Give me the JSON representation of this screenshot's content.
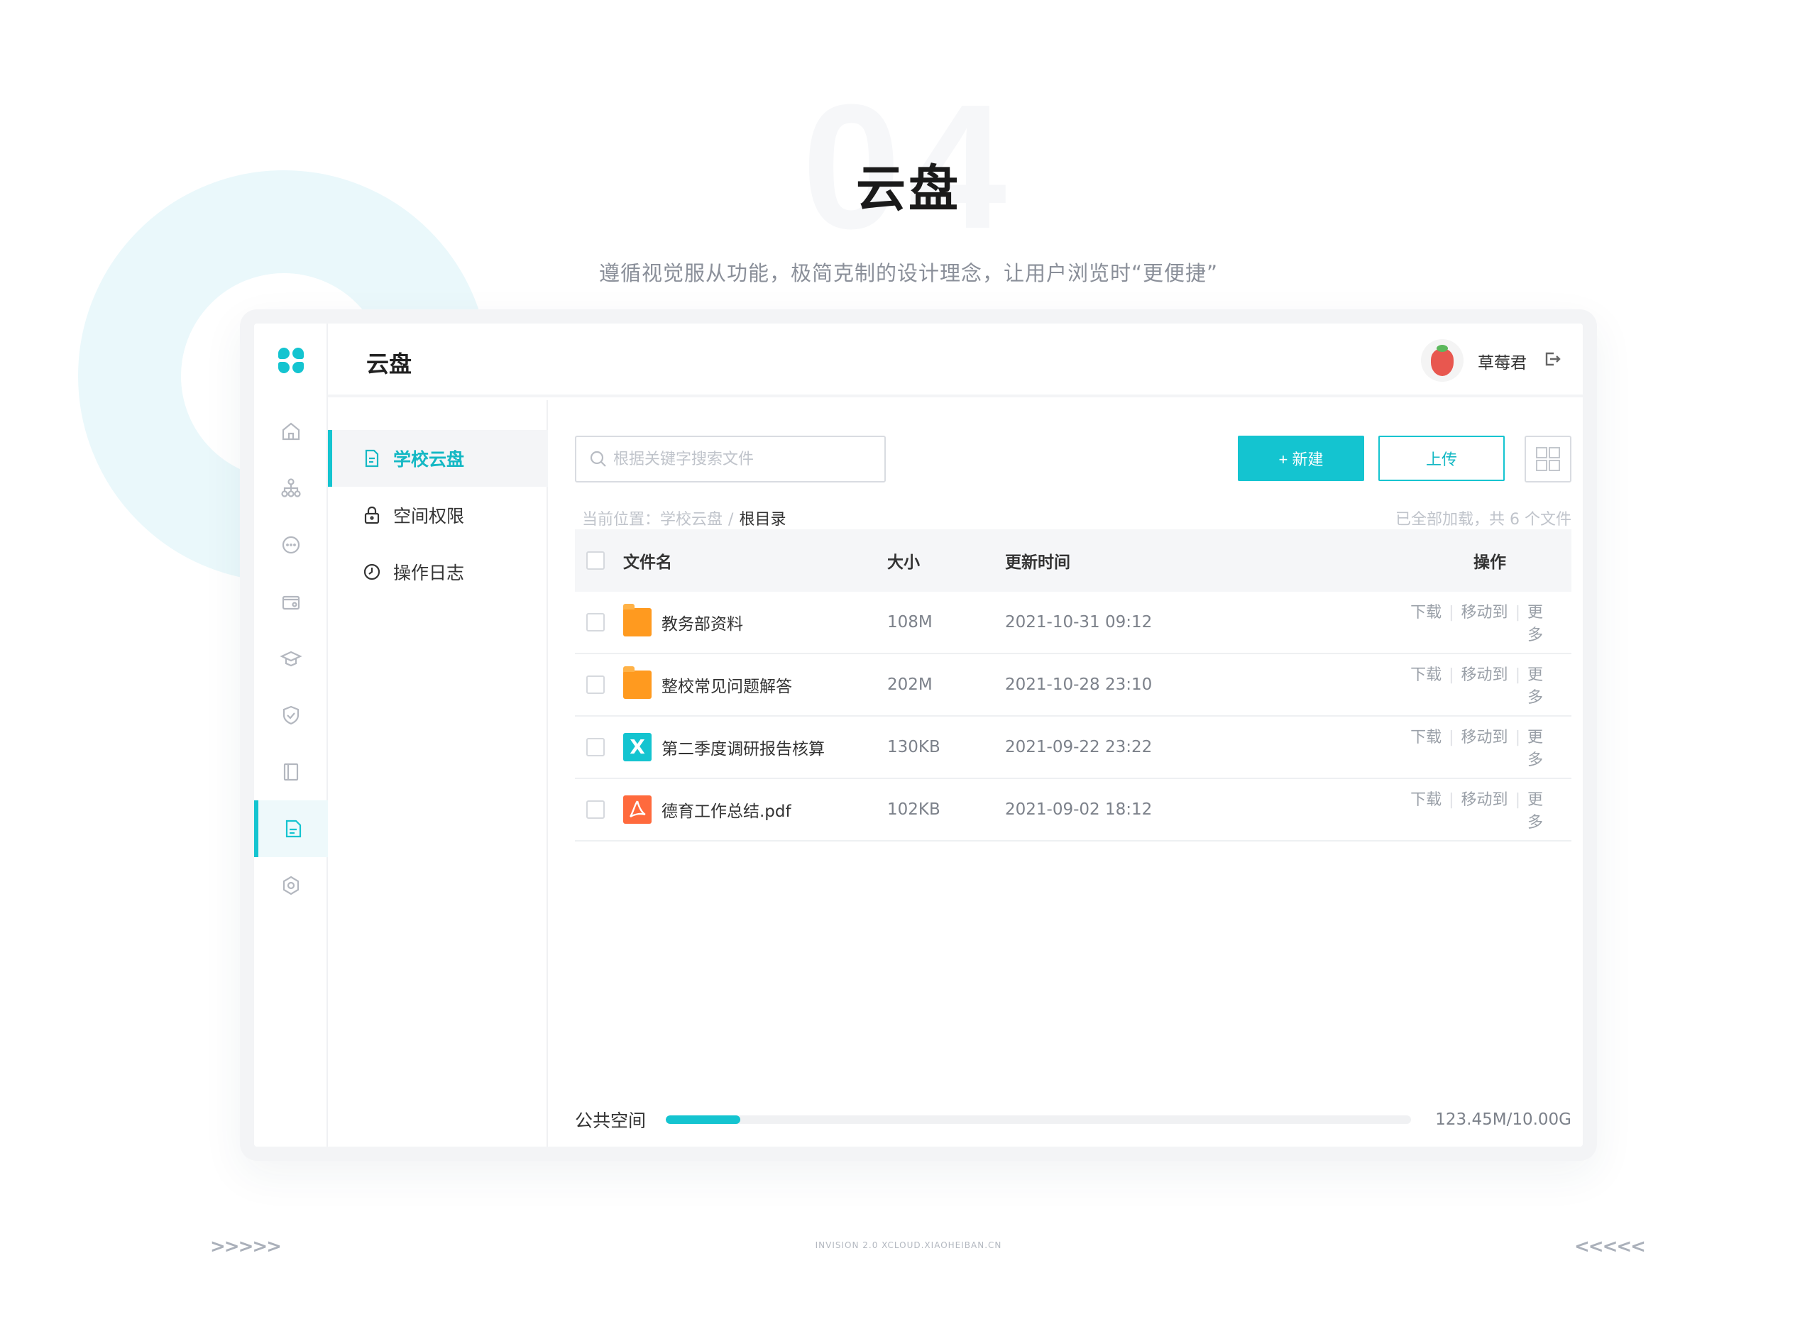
{
  "hero": {
    "number": "04",
    "title": "云盘",
    "subtitle": "遵循视觉服从功能，极简克制的设计理念，让用户浏览时“更便捷”"
  },
  "app": {
    "title": "云盘",
    "user_name": "草莓君",
    "accent_color": "#14c4d0"
  },
  "rail": {
    "items": [
      "home-icon",
      "org-chart-icon",
      "message-icon",
      "wallet-icon",
      "graduation-cap-icon",
      "shield-check-icon",
      "book-icon",
      "cloud-drive-icon",
      "settings-icon"
    ],
    "active": "cloud-drive-icon"
  },
  "subnav": {
    "items": [
      {
        "label": "学校云盘",
        "icon": "document-icon",
        "active": true
      },
      {
        "label": "空间权限",
        "icon": "lock-icon",
        "active": false
      },
      {
        "label": "操作日志",
        "icon": "clock-icon",
        "active": false
      }
    ]
  },
  "toolbar": {
    "search_placeholder": "根据关键字搜索文件",
    "new_label": "+ 新建",
    "upload_label": "上传"
  },
  "breadcrumb": {
    "prefix": "当前位置：",
    "parent": "学校云盘",
    "separator": "/",
    "current": "根目录"
  },
  "loaded_status": "已全部加载，共 6 个文件",
  "table": {
    "headers": {
      "name": "文件名",
      "size": "大小",
      "time": "更新时间",
      "ops": "操作"
    },
    "ops_labels": {
      "download": "下载",
      "move": "移动到",
      "more": "更多",
      "divider": "|"
    },
    "rows": [
      {
        "type": "folder",
        "name": "教务部资料",
        "size": "108M",
        "time": "2021-10-31  09:12"
      },
      {
        "type": "folder",
        "name": "整校常见问题解答",
        "size": "202M",
        "time": "2021-10-28  23:10"
      },
      {
        "type": "xls",
        "icon_glyph": "X",
        "name": "第二季度调研报告核算",
        "size": "130KB",
        "time": "2021-09-22  23:22"
      },
      {
        "type": "pdf",
        "name": "德育工作总结.pdf",
        "size": "102KB",
        "time": "2021-09-02  18:12"
      }
    ]
  },
  "storage": {
    "label": "公共空间",
    "value_text": "123.45M/10.00G",
    "used_fraction": 0.1
  },
  "decor": {
    "arrows_left": ">>>>>",
    "arrows_right": "<<<<<",
    "footer_note": "INVISION 2.0  XCLOUD.XIAOHEIBAN.CN"
  }
}
